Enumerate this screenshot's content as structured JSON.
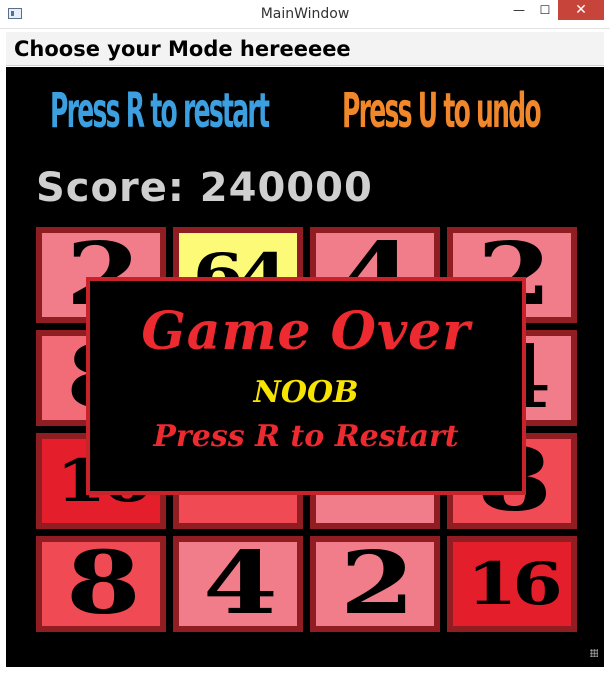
{
  "window": {
    "title": "MainWindow",
    "minimize": "—",
    "maximize": "☐",
    "close": "✕"
  },
  "menu": {
    "mode_label": "Choose your Mode hereeeee"
  },
  "hints": {
    "restart": "Press R to restart",
    "undo": "Press U to undo"
  },
  "score": {
    "text": "Score: 240000"
  },
  "tiles": [
    {
      "value": "2",
      "color": "#f27d8a"
    },
    {
      "value": "64",
      "color": "#fdfa78"
    },
    {
      "value": "4",
      "color": "#f27d8a"
    },
    {
      "value": "2",
      "color": "#f27d8a"
    },
    {
      "value": "8",
      "color": "#f26c78"
    },
    {
      "value": "",
      "color": "#f26c78"
    },
    {
      "value": "",
      "color": "#f26c78"
    },
    {
      "value": "4",
      "color": "#f27d8a"
    },
    {
      "value": "16",
      "color": "#e51e2b"
    },
    {
      "value": "",
      "color": "#f04a55"
    },
    {
      "value": "",
      "color": "#f27d8a"
    },
    {
      "value": "8",
      "color": "#f04a55"
    },
    {
      "value": "8",
      "color": "#f04a55"
    },
    {
      "value": "4",
      "color": "#f27d8a"
    },
    {
      "value": "2",
      "color": "#f27d8a"
    },
    {
      "value": "16",
      "color": "#e51e2b"
    }
  ],
  "game_over": {
    "title": "Game Over",
    "subtitle": "NOOB",
    "instruction": "Press R to Restart"
  }
}
